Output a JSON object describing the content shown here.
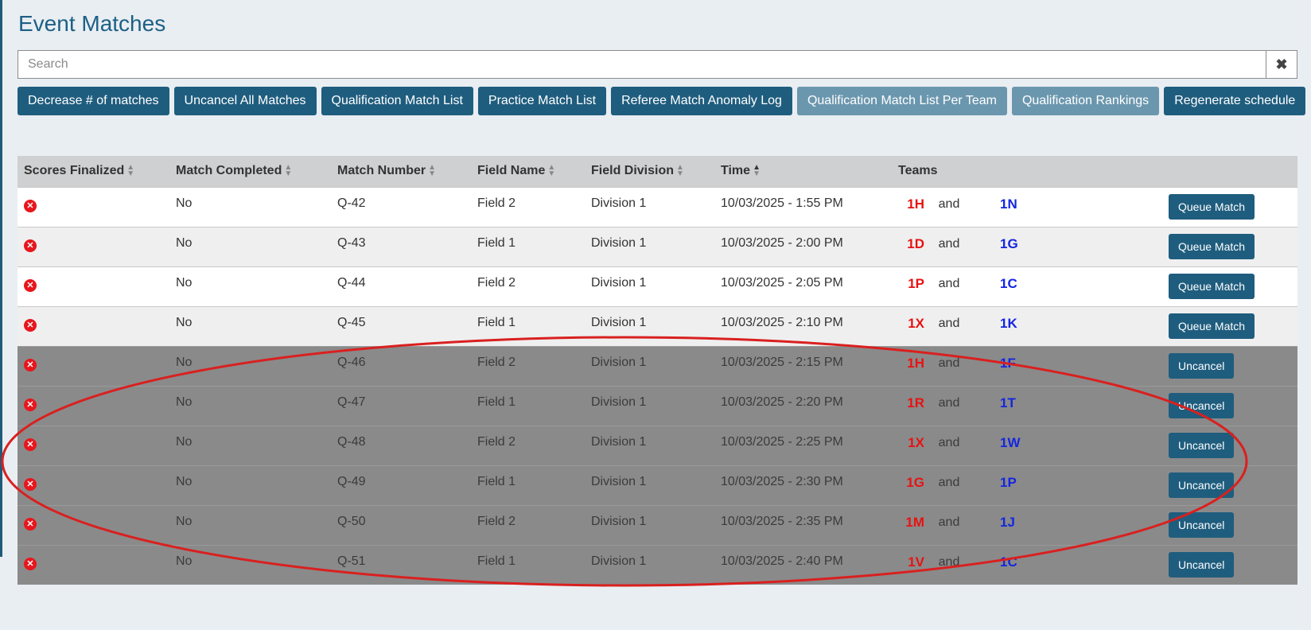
{
  "page": {
    "title": "Event Matches"
  },
  "search": {
    "placeholder": "Search",
    "clear_label": "✖"
  },
  "toolbar": {
    "buttons": [
      {
        "label": "Decrease # of matches",
        "style": "dark"
      },
      {
        "label": "Uncancel All Matches",
        "style": "dark"
      },
      {
        "label": "Qualification Match List",
        "style": "dark"
      },
      {
        "label": "Practice Match List",
        "style": "dark"
      },
      {
        "label": "Referee Match Anomaly Log",
        "style": "dark"
      },
      {
        "label": "Qualification Match List Per Team",
        "style": "light"
      },
      {
        "label": "Qualification Rankings",
        "style": "light"
      },
      {
        "label": "Regenerate schedule",
        "style": "dark"
      }
    ]
  },
  "table": {
    "columns": [
      {
        "label": "Scores Finalized",
        "sort": "both"
      },
      {
        "label": "Match Completed",
        "sort": "both"
      },
      {
        "label": "Match Number",
        "sort": "both"
      },
      {
        "label": "Field Name",
        "sort": "both"
      },
      {
        "label": "Field Division",
        "sort": "both"
      },
      {
        "label": "Time",
        "sort": "asc"
      },
      {
        "label": "Teams",
        "sort": "none"
      }
    ],
    "and_label": "and",
    "rows": [
      {
        "completed": "No",
        "match": "Q-42",
        "field": "Field 2",
        "division": "Division 1",
        "time": "10/03/2025 - 1:55 PM",
        "red": "1H",
        "blue": "1N",
        "action": "Queue Match",
        "cancelled": false
      },
      {
        "completed": "No",
        "match": "Q-43",
        "field": "Field 1",
        "division": "Division 1",
        "time": "10/03/2025 - 2:00 PM",
        "red": "1D",
        "blue": "1G",
        "action": "Queue Match",
        "cancelled": false
      },
      {
        "completed": "No",
        "match": "Q-44",
        "field": "Field 2",
        "division": "Division 1",
        "time": "10/03/2025 - 2:05 PM",
        "red": "1P",
        "blue": "1C",
        "action": "Queue Match",
        "cancelled": false
      },
      {
        "completed": "No",
        "match": "Q-45",
        "field": "Field 1",
        "division": "Division 1",
        "time": "10/03/2025 - 2:10 PM",
        "red": "1X",
        "blue": "1K",
        "action": "Queue Match",
        "cancelled": false
      },
      {
        "completed": "No",
        "match": "Q-46",
        "field": "Field 2",
        "division": "Division 1",
        "time": "10/03/2025 - 2:15 PM",
        "red": "1H",
        "blue": "1F",
        "action": "Uncancel",
        "cancelled": true
      },
      {
        "completed": "No",
        "match": "Q-47",
        "field": "Field 1",
        "division": "Division 1",
        "time": "10/03/2025 - 2:20 PM",
        "red": "1R",
        "blue": "1T",
        "action": "Uncancel",
        "cancelled": true
      },
      {
        "completed": "No",
        "match": "Q-48",
        "field": "Field 2",
        "division": "Division 1",
        "time": "10/03/2025 - 2:25 PM",
        "red": "1X",
        "blue": "1W",
        "action": "Uncancel",
        "cancelled": true
      },
      {
        "completed": "No",
        "match": "Q-49",
        "field": "Field 1",
        "division": "Division 1",
        "time": "10/03/2025 - 2:30 PM",
        "red": "1G",
        "blue": "1P",
        "action": "Uncancel",
        "cancelled": true
      },
      {
        "completed": "No",
        "match": "Q-50",
        "field": "Field 2",
        "division": "Division 1",
        "time": "10/03/2025 - 2:35 PM",
        "red": "1M",
        "blue": "1J",
        "action": "Uncancel",
        "cancelled": true
      },
      {
        "completed": "No",
        "match": "Q-51",
        "field": "Field 1",
        "division": "Division 1",
        "time": "10/03/2025 - 2:40 PM",
        "red": "1V",
        "blue": "1C",
        "action": "Uncancel",
        "cancelled": true
      }
    ]
  },
  "colors": {
    "accent": "#1f5d7e",
    "accent_light": "#6b97ae",
    "red_team": "#e81212",
    "blue_team": "#1426e0",
    "cancelled_row": "#8a8a8a",
    "annotation": "#d9201f"
  }
}
